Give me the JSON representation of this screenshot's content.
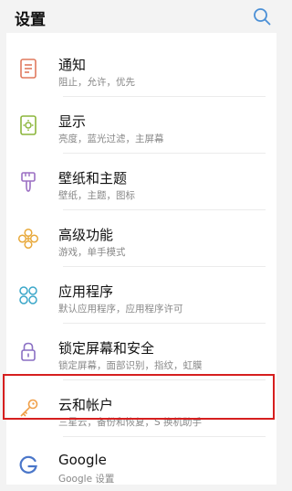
{
  "header": {
    "title": "设置",
    "search_icon": "search-icon"
  },
  "items": [
    {
      "label": "通知",
      "sub": "阻止，允许，优先",
      "icon": "notification-icon",
      "color": "#e07a5f"
    },
    {
      "label": "显示",
      "sub": "亮度，蓝光过滤，主屏幕",
      "icon": "display-icon",
      "color": "#8cb63c"
    },
    {
      "label": "壁纸和主题",
      "sub": "壁纸，主题，图标",
      "icon": "wallpaper-theme-icon",
      "color": "#9b6fc3"
    },
    {
      "label": "高级功能",
      "sub": "游戏，单手模式",
      "icon": "advanced-features-icon",
      "color": "#e8a93b"
    },
    {
      "label": "应用程序",
      "sub": "默认应用程序，应用程序许可",
      "icon": "apps-icon",
      "color": "#3ba7c9"
    },
    {
      "label": "锁定屏幕和安全",
      "sub": "锁定屏幕，面部识别，指纹，虹膜",
      "icon": "lock-icon",
      "color": "#8a6fc3"
    },
    {
      "label": "云和帐户",
      "sub": "三星云，备份和恢复，S 换机助手",
      "icon": "key-icon",
      "color": "#f0a04a",
      "highlighted": true
    },
    {
      "label": "Google",
      "sub": "Google 设置",
      "icon": "google-icon",
      "color": "#4a76c9"
    }
  ],
  "colors": {
    "highlight": "#d61f1f",
    "search": "#4a8fd6"
  }
}
